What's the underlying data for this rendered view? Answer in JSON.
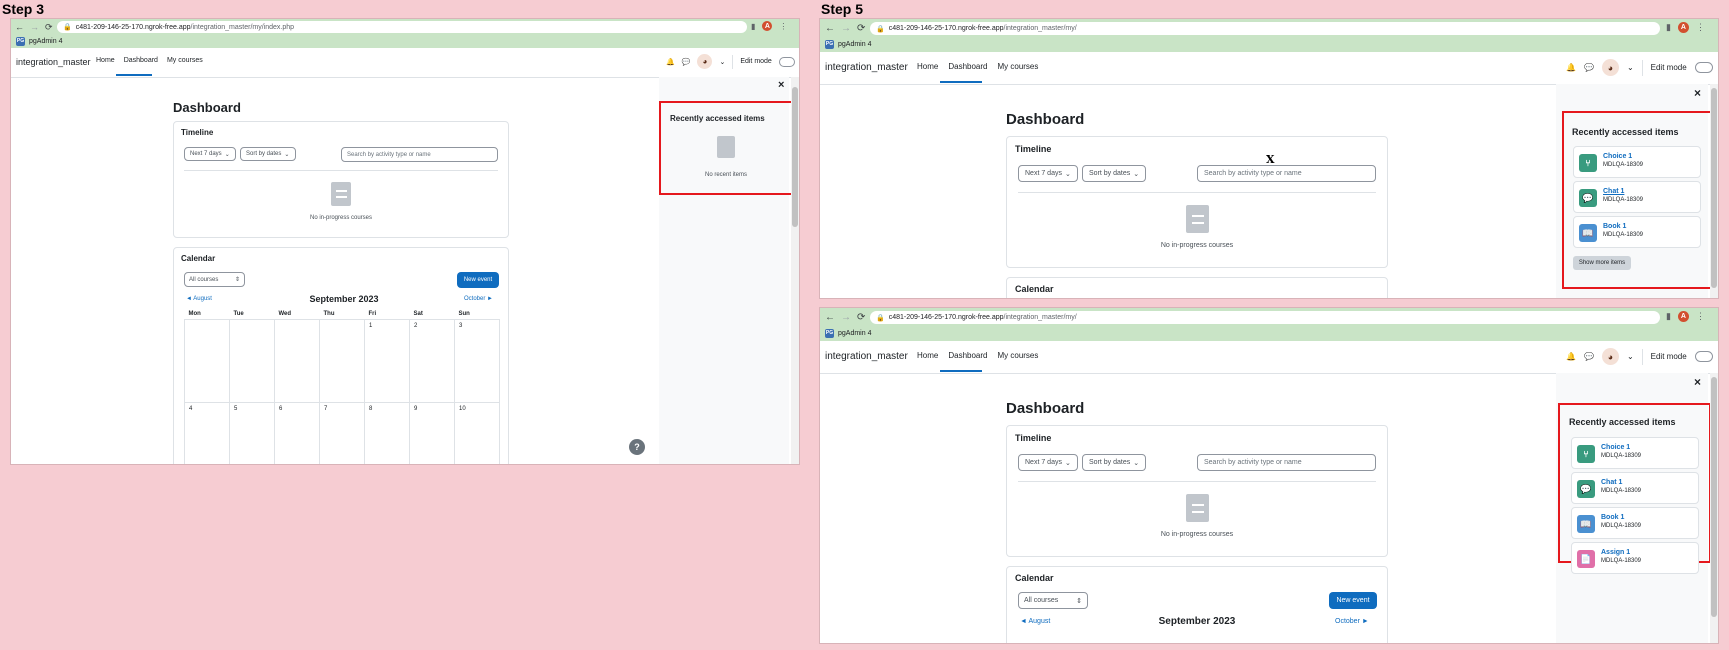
{
  "labels": {
    "step3": "Step 3",
    "step5": "Step 5"
  },
  "shots": {
    "step3": {
      "url_host": "c481-209-146-25-170.ngrok-free.app",
      "url_path": "/integration_master/my/index.php",
      "profile_letter": "A",
      "bookmark": "pgAdmin 4",
      "bookmark_icon": "PG",
      "brand": "integration_master",
      "nav": [
        "Home",
        "Dashboard",
        "My courses"
      ],
      "edit_mode": "Edit mode",
      "close": "×",
      "page_title": "Dashboard",
      "timeline": {
        "title": "Timeline",
        "filter": "Next 7 days",
        "sort": "Sort by dates",
        "search_placeholder": "Search by activity type or name",
        "empty": "No in-progress courses"
      },
      "calendar": {
        "title": "Calendar",
        "courses": "All courses",
        "new_event": "New event",
        "prev": "◄ August",
        "month": "September 2023",
        "next": "October ►",
        "days": [
          "Mon",
          "Tue",
          "Wed",
          "Thu",
          "Fri",
          "Sat",
          "Sun"
        ],
        "rows": [
          [
            "",
            "",
            "",
            "",
            "1",
            "2",
            "3"
          ],
          [
            "4",
            "5",
            "6",
            "7",
            "8",
            "9",
            "10"
          ]
        ]
      },
      "recent": {
        "title": "Recently accessed items",
        "empty": "No recent items",
        "items": []
      },
      "help": "?"
    },
    "step5a": {
      "url_host": "c481-209-146-25-170.ngrok-free.app",
      "url_path": "/integration_master/my/",
      "profile_letter": "A",
      "bookmark": "pgAdmin 4",
      "bookmark_icon": "PG",
      "brand": "integration_master",
      "nav": [
        "Home",
        "Dashboard",
        "My courses"
      ],
      "edit_mode": "Edit mode",
      "close": "×",
      "page_title": "Dashboard",
      "cursor": "X",
      "timeline": {
        "title": "Timeline",
        "filter": "Next 7 days",
        "sort": "Sort by dates",
        "search_placeholder": "Search by activity type or name",
        "empty": "No in-progress courses"
      },
      "calendar": {
        "title": "Calendar"
      },
      "recent": {
        "title": "Recently accessed items",
        "items": [
          {
            "name": "Choice 1",
            "course": "MDLQA-18309",
            "icon": "choice-icon",
            "color": "#399b7f",
            "glyph": "⑂"
          },
          {
            "name": "Chat 1",
            "course": "MDLQA-18309",
            "icon": "chat-icon",
            "color": "#399b7f",
            "glyph": "💬"
          },
          {
            "name": "Book 1",
            "course": "MDLQA-18309",
            "icon": "book-icon",
            "color": "#4a90d1",
            "glyph": "📖"
          }
        ],
        "more": "Show more items"
      }
    },
    "step5b": {
      "url_host": "c481-209-146-25-170.ngrok-free.app",
      "url_path": "/integration_master/my/",
      "profile_letter": "A",
      "bookmark": "pgAdmin 4",
      "bookmark_icon": "PG",
      "brand": "integration_master",
      "nav": [
        "Home",
        "Dashboard",
        "My courses"
      ],
      "edit_mode": "Edit mode",
      "close": "×",
      "page_title": "Dashboard",
      "timeline": {
        "title": "Timeline",
        "filter": "Next 7 days",
        "sort": "Sort by dates",
        "search_placeholder": "Search by activity type or name",
        "empty": "No in-progress courses"
      },
      "calendar": {
        "title": "Calendar",
        "courses": "All courses",
        "new_event": "New event",
        "prev": "◄ August",
        "month": "September 2023",
        "next": "October ►"
      },
      "recent": {
        "title": "Recently accessed items",
        "items": [
          {
            "name": "Choice 1",
            "course": "MDLQA-18309",
            "icon": "choice-icon",
            "color": "#399b7f",
            "glyph": "⑂"
          },
          {
            "name": "Chat 1",
            "course": "MDLQA-18309",
            "icon": "chat-icon",
            "color": "#399b7f",
            "glyph": "💬"
          },
          {
            "name": "Book 1",
            "course": "MDLQA-18309",
            "icon": "book-icon",
            "color": "#4a90d1",
            "glyph": "📖"
          },
          {
            "name": "Assign 1",
            "course": "MDLQA-18309",
            "icon": "assign-icon",
            "color": "#e06fa8",
            "glyph": "📄"
          }
        ]
      }
    }
  },
  "colors": {
    "background": "#f6ccd2",
    "accent": "#0f6cbf",
    "highlight": "#e5181d",
    "browser_bar": "#c9e4c6"
  }
}
